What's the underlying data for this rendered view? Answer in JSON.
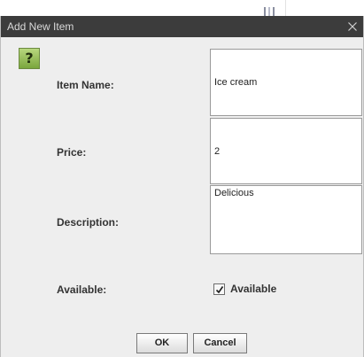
{
  "dialog": {
    "title": "Add New Item",
    "help_icon": "question-mark-icon",
    "help_glyph": "?",
    "close_icon": "close-icon"
  },
  "form": {
    "item_name": {
      "label": "Item Name:",
      "value": "Ice cream"
    },
    "price": {
      "label": "Price:",
      "value": "2"
    },
    "description": {
      "label": "Description:",
      "value": "Delicious"
    },
    "available": {
      "label": "Available:",
      "checkbox_label": "Available",
      "checked": true
    }
  },
  "buttons": {
    "ok_label": "OK",
    "cancel_label": "Cancel"
  },
  "colors": {
    "titlebar": "#3c3c3c",
    "dialog_background": "#eeeeee",
    "help_icon_green": "#8fb84e"
  }
}
